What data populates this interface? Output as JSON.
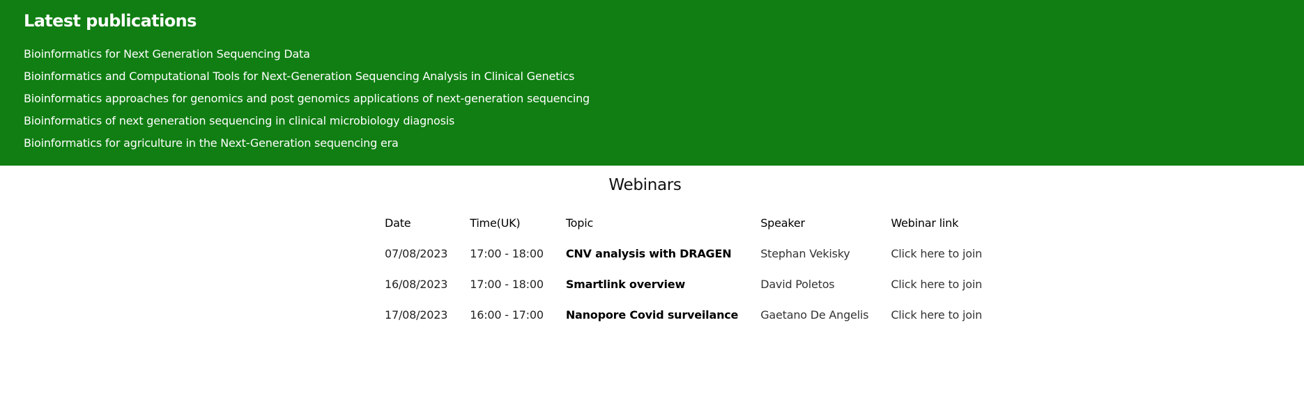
{
  "publications": {
    "title": "Latest publications",
    "items": [
      "Bioinformatics for Next Generation Sequencing Data",
      "Bioinformatics and Computational Tools for Next-Generation Sequencing Analysis in Clinical Genetics",
      "Bioinformatics approaches for genomics and post genomics applications of next-generation sequencing",
      "Bioinformatics of next generation sequencing in clinical microbiology diagnosis",
      "Bioinformatics for agriculture in the Next-Generation sequencing era"
    ],
    "background_color": "#107e12"
  },
  "webinars": {
    "title": "Webinars",
    "headers": [
      "Date",
      "Time(UK)",
      "Topic",
      "Speaker",
      "Webinar link"
    ],
    "rows": [
      {
        "date": "07/08/2023",
        "time": "17:00 - 18:00",
        "topic": "CNV analysis with DRAGEN",
        "speaker": "Stephan Vekisky",
        "link": "Click here to join"
      },
      {
        "date": "16/08/2023",
        "time": "17:00 - 18:00",
        "topic": "Smartlink overview",
        "speaker": "David Poletos",
        "link": "Click here to join"
      },
      {
        "date": "17/08/2023",
        "time": "16:00 - 17:00",
        "topic": "Nanopore Covid surveilance",
        "speaker": "Gaetano De Angelis",
        "link": "Click here to join"
      }
    ]
  }
}
